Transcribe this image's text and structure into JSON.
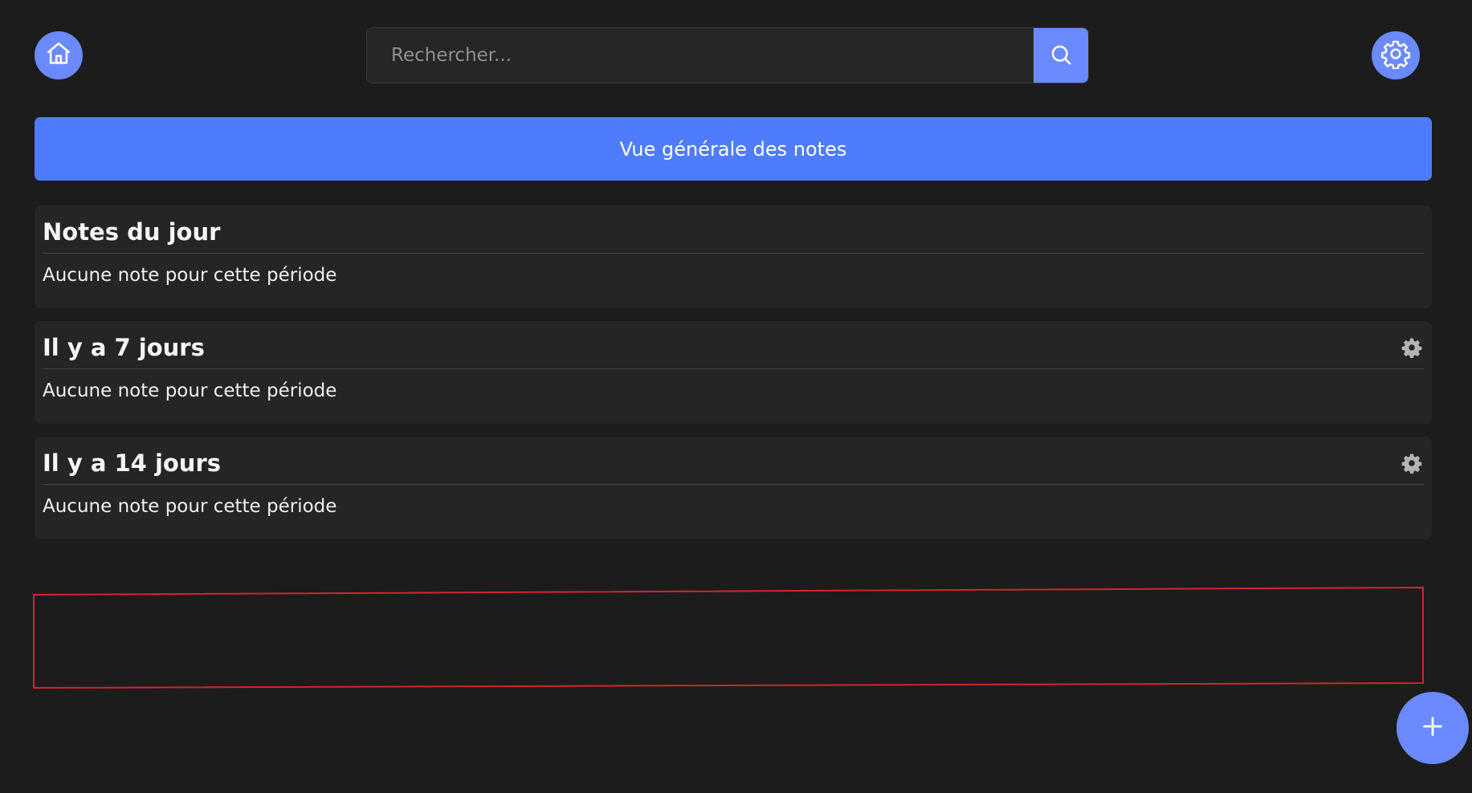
{
  "header": {
    "home_icon": "home-icon",
    "settings_icon": "gear-icon",
    "search": {
      "placeholder": "Rechercher...",
      "value": "",
      "button_icon": "search-icon"
    }
  },
  "overview": {
    "label": "Vue générale des notes"
  },
  "sections": [
    {
      "title": "Notes du jour",
      "empty_text": "Aucune note pour cette période",
      "has_settings": false
    },
    {
      "title": "Il y a 7 jours",
      "empty_text": "Aucune note pour cette période",
      "has_settings": true,
      "settings_icon": "gear-icon"
    },
    {
      "title": "Il y a 14 jours",
      "empty_text": "Aucune note pour cette période",
      "has_settings": true,
      "settings_icon": "gear-icon"
    }
  ],
  "fab": {
    "icon": "plus-icon"
  },
  "colors": {
    "background": "#1c1c1d",
    "card": "#252526",
    "accent": "#6b8afd",
    "overview": "#4f7cfd",
    "outline": "#d0262d"
  }
}
